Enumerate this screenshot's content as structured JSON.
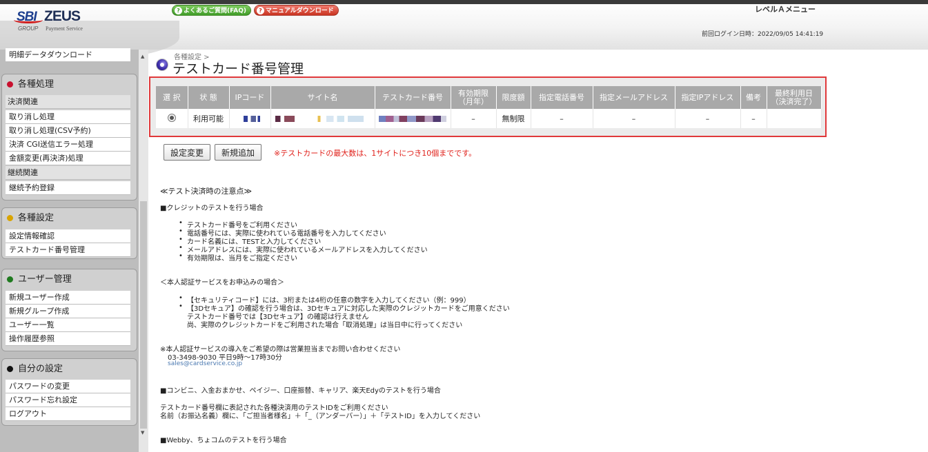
{
  "header": {
    "logo": {
      "sbi": "SBI",
      "zeus": "ZEUS",
      "group": "GROUP",
      "payment_service": "Payment Service"
    },
    "faq_button": "よくあるご質問(FAQ)",
    "manual_button": "マニュアルダウンロード",
    "level_menu": "レベルＡメニュー",
    "last_login": "前回ログイン日時：2022/09/05 14:41:19"
  },
  "sidebar": {
    "top_item": "明細データダウンロード",
    "sections": [
      {
        "title": "各種処理",
        "dot_color": "#c8102e",
        "groups": [
          {
            "label": "決済関連",
            "items": [
              "取り消し処理",
              "取り消し処理(CSV予約)",
              "決済 CGI送信エラー処理",
              "金額変更(再決済)処理"
            ]
          },
          {
            "label": "継続関連",
            "items": [
              "継続予約登録"
            ]
          }
        ]
      },
      {
        "title": "各種設定",
        "dot_color": "#d9a400",
        "items": [
          "設定情報確認",
          "テストカード番号管理"
        ]
      },
      {
        "title": "ユーザー管理",
        "dot_color": "#1f7a1f",
        "items": [
          "新規ユーザー作成",
          "新規グループ作成",
          "ユーザー一覧",
          "操作履歴参照"
        ]
      },
      {
        "title": "自分の設定",
        "dot_color": "#111111",
        "items": [
          "パスワードの変更",
          "パスワード忘れ設定",
          "ログアウト"
        ]
      }
    ]
  },
  "main": {
    "breadcrumb": "各種設定 >",
    "title": "テストカード番号管理",
    "table": {
      "headers": [
        "選 択",
        "状 態",
        "IPコード",
        "サイト名",
        "テストカード番号",
        "有効期限\n（月年）",
        "限度額",
        "指定電話番号",
        "指定メールアドレス",
        "指定IPアドレス",
        "備考",
        "最終利用日\n（決済完了）"
      ],
      "row": {
        "status": "利用可能",
        "expiry": "–",
        "limit": "無制限",
        "phone": "–",
        "email": "–",
        "ip": "–",
        "memo": "–",
        "last_used": ""
      }
    },
    "buttons": {
      "change": "設定変更",
      "add": "新規追加"
    },
    "max_note": "※テストカードの最大数は、1サイトにつき10個までです。",
    "notes": {
      "heading": "≪テスト決済時の注意点≫",
      "credit_title": "■クレジットのテストを行う場合",
      "credit_items": [
        "テストカード番号をご利用ください",
        "電話番号には、実際に使われている電話番号を入力してください",
        "カード名義には、TESTと入力してください",
        "メールアドレスには、実際に使われているメールアドレスを入力してください",
        "有効期限は、当月をご指定ください"
      ],
      "auth_title": "＜本人認証サービスをお申込みの場合＞",
      "auth_items": [
        "【セキュリティコード】には、3桁または4桁の任意の数字を入力してください（例：999）",
        "【3Dセキュア】の確認を行う場合は、3Dセキュアに対応した実際のクレジットカードをご用意ください"
      ],
      "auth_sub1": "テストカード番号では【3Dセキュア】の確認は行えません",
      "auth_sub2": "尚、実際のクレジットカードをご利用された場合「取消処理」は当日中に行ってください",
      "contact_title": "※本人認証サービスの導入をご希望の際は営業担当までお問い合わせください",
      "contact_phone": "03-3498-9030 平日9時～17時30分",
      "contact_email": "sales@cardservice.co.jp",
      "conv_title": "■コンビニ、入金おまかせ、ペイジー、口座振替、キャリア、楽天Edyのテストを行う場合",
      "conv_line1": "テストカード番号欄に表記された各種決済用のテストIDをご利用ください",
      "conv_line2": "名前（お振込名義）欄に、「ご担当者様名」＋「_（アンダーバー）」＋「テストID」を入力してください",
      "webby_title": "■Webby、ちょコムのテストを行う場合"
    }
  }
}
